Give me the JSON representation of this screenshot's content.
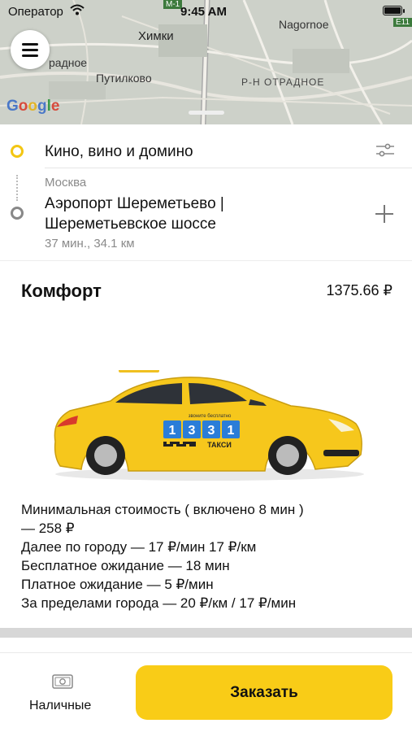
{
  "status_bar": {
    "carrier": "Оператор",
    "time": "9:45 AM"
  },
  "map": {
    "labels": {
      "khimki": "Химки",
      "nagornoe": "Nagornoe",
      "putilkovo": "Путилково",
      "district": "Р-Н ОТРАДНОЕ",
      "left_partial": "радное",
      "road_e1": "E11",
      "road_m": "M-1"
    },
    "google": [
      "G",
      "o",
      "o",
      "g",
      "l",
      "e"
    ]
  },
  "route": {
    "from": "Кино, вино и домино",
    "to_city": "Москва",
    "to_lines": [
      "Аэропорт Шереметьево |",
      "Шереметьевское шоссе"
    ],
    "meta": "37 мин., 34.1 км"
  },
  "tariff": {
    "name": "Комфорт",
    "price": "1375.66 ₽"
  },
  "car": {
    "phone_top": "звоните бесплатно",
    "digits": [
      "1",
      "3",
      "3",
      "1"
    ],
    "brand": "ТАКСИ"
  },
  "info_lines": [
    "Минимальная стоимость ( включено 8 мин  )",
    "— 258 ₽",
    "Далее по городу — 17 ₽/мин 17 ₽/км",
    "Бесплатное ожидание — 18 мин",
    "Платное ожидание  —     5 ₽/мин",
    "За пределами города — 20 ₽/км / 17 ₽/мин"
  ],
  "footer": {
    "payment_label": "Наличные",
    "order_label": "Заказать"
  },
  "colors": {
    "accent": "#f9cc17",
    "from_dot": "#f3c613"
  }
}
